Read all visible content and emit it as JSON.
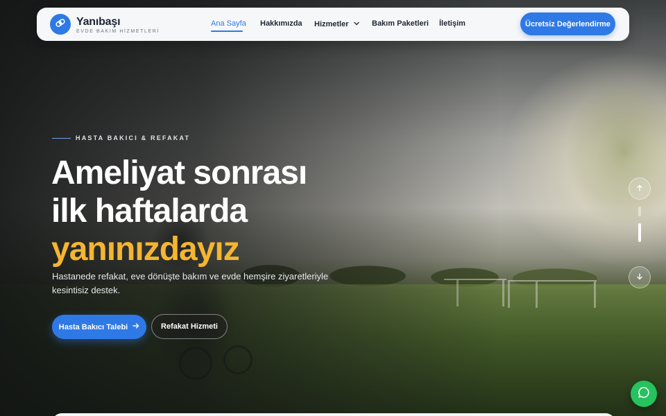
{
  "brand": {
    "name": "Yanıbaşı",
    "tagline": "EVDE BAKIM HİZMETLERİ",
    "logo_icon": "bandage-icon",
    "accent_color": "#2f79e6"
  },
  "nav": {
    "items": [
      {
        "label": "Ana Sayfa",
        "active": true
      },
      {
        "label": "Hakkımızda",
        "active": false
      },
      {
        "label": "Hizmetler",
        "active": false,
        "dropdown": true
      },
      {
        "label": "Bakım Paketleri",
        "active": false
      },
      {
        "label": "İletişim",
        "active": false
      }
    ],
    "cta_label": "Ücretsiz Değerlendirme"
  },
  "hero": {
    "eyebrow": "HASTA BAKICI & REFAKAT",
    "headline_line1": "Ameliyat sonrası",
    "headline_line2": "ilk haftalarda",
    "headline_highlight": "yanınızdayız",
    "highlight_color": "#f5b531",
    "subtext": "Hastanede refakat, eve dönüşte bakım ve evde hemşire ziyaretleriyle kesintisiz destek.",
    "primary_button": "Hasta Bakıcı Talebi",
    "secondary_button": "Refakat Hizmeti"
  },
  "slider": {
    "prev_icon": "arrow-up-icon",
    "next_icon": "arrow-down-icon",
    "slide_count": 2,
    "active_index": 1
  },
  "floating": {
    "whatsapp_icon": "chat-bubble-icon",
    "whatsapp_color": "#25c25e"
  }
}
